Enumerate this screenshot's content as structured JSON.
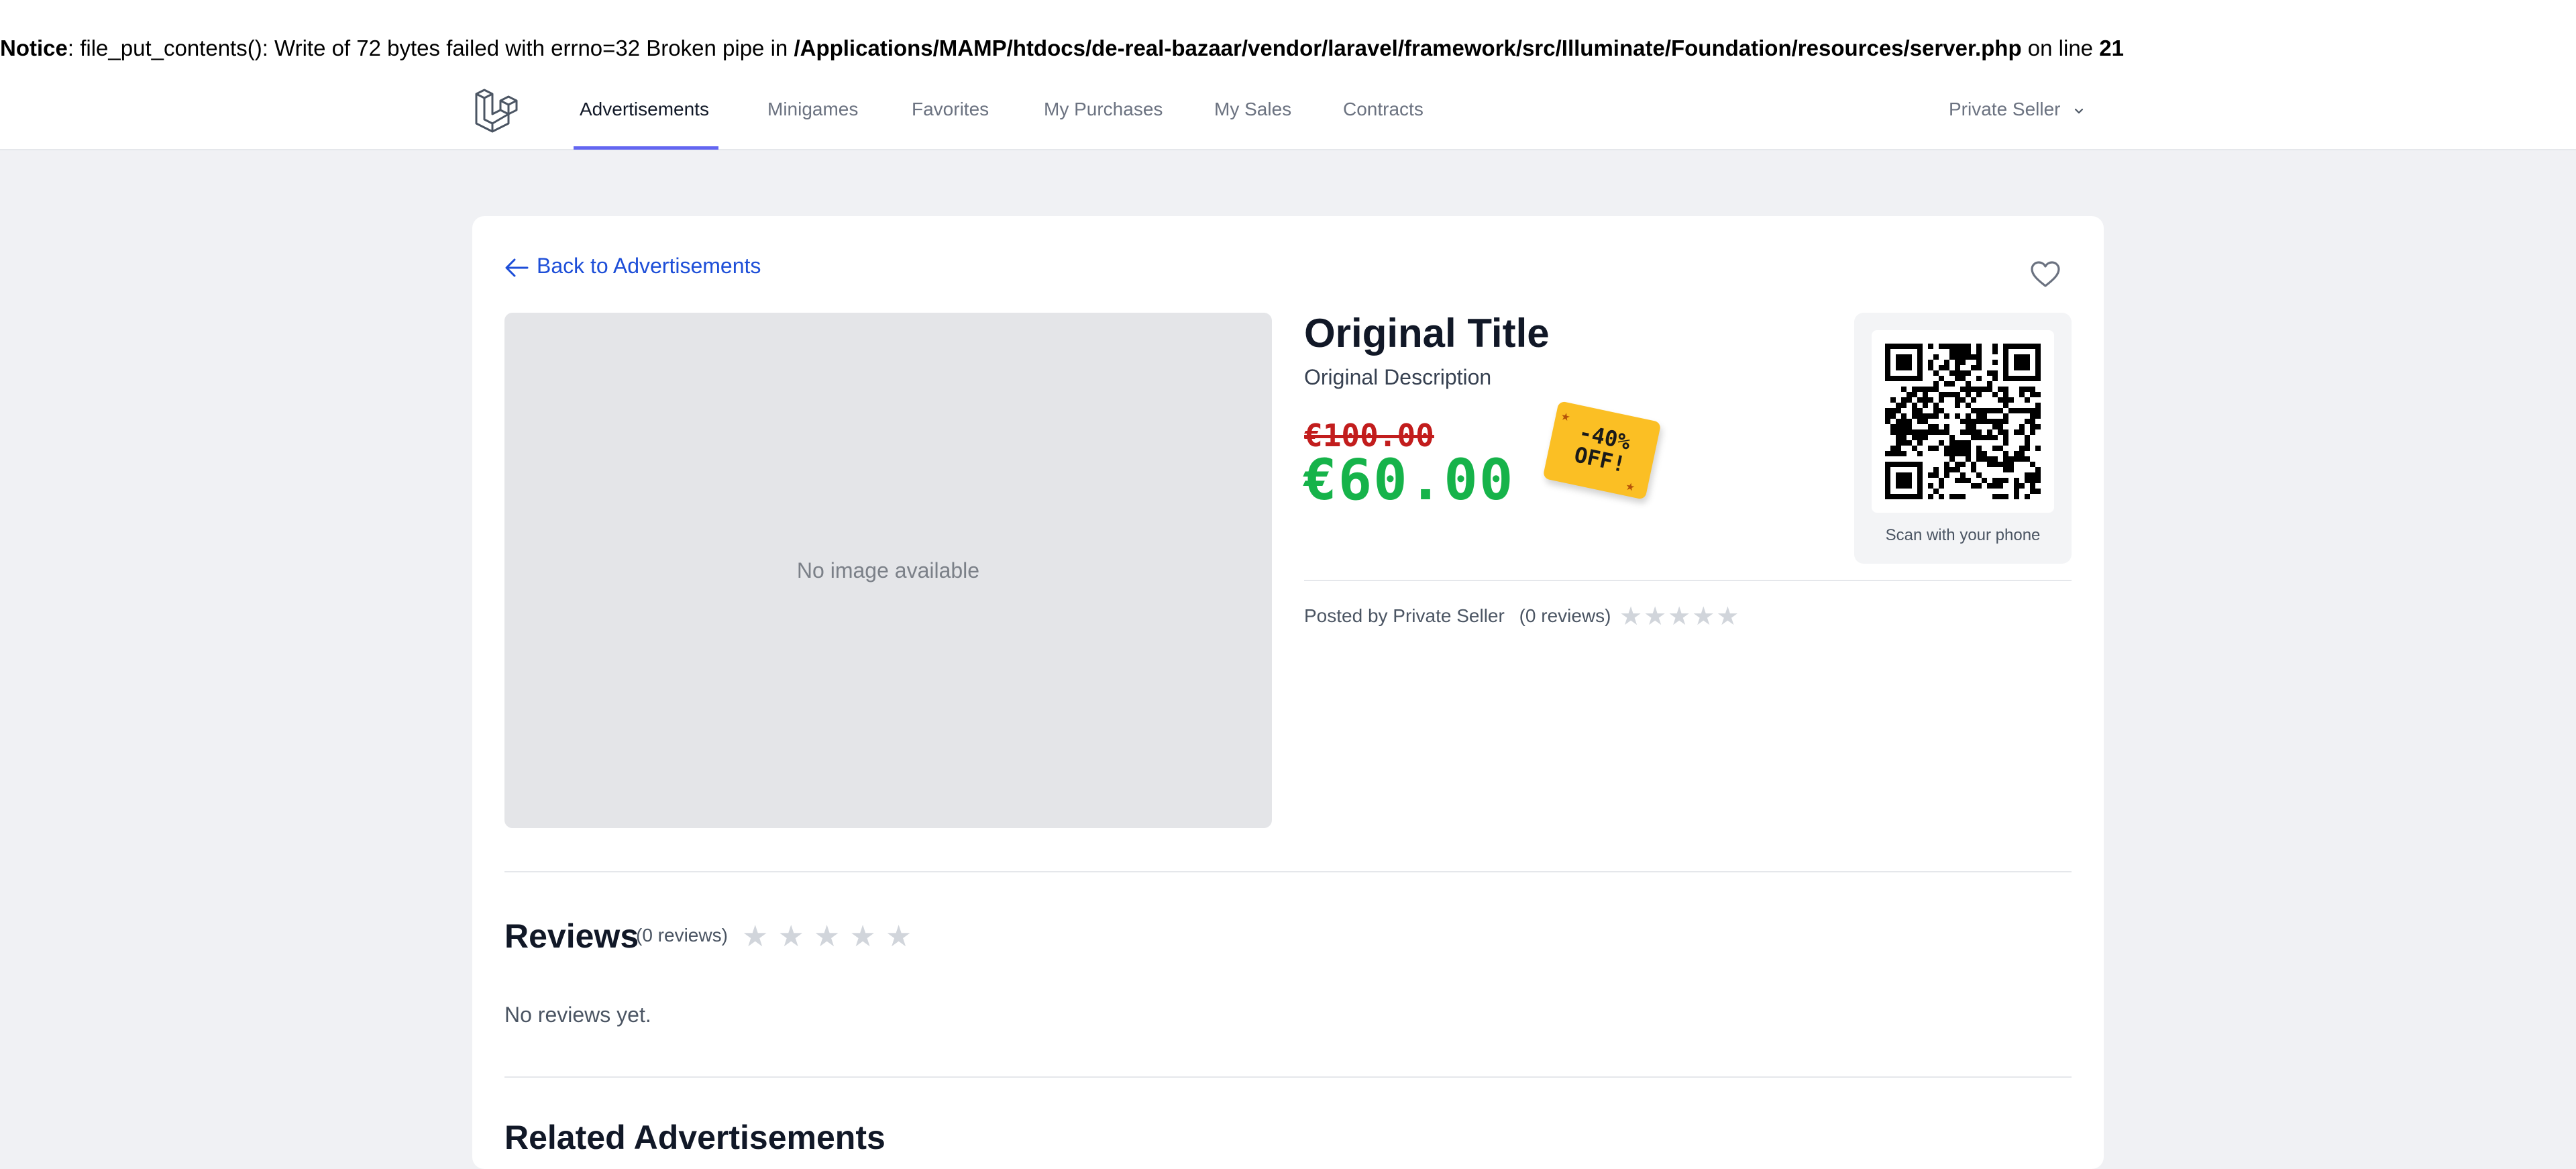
{
  "notice": {
    "label": "Notice",
    "message": ": file_put_contents(): Write of 72 bytes failed with errno=32 Broken pipe in ",
    "path": "/Applications/MAMP/htdocs/de-real-bazaar/vendor/laravel/framework/src/Illuminate/Foundation/resources/server.php",
    "on_line_text": " on line ",
    "line_number": "21"
  },
  "nav": {
    "logo_icon": "laravel-logo-icon",
    "links": [
      {
        "label": "Advertisements",
        "active": true
      },
      {
        "label": "Minigames",
        "active": false
      },
      {
        "label": "Favorites",
        "active": false
      },
      {
        "label": "My Purchases",
        "active": false
      },
      {
        "label": "My Sales",
        "active": false
      },
      {
        "label": "Contracts",
        "active": false
      }
    ],
    "user_menu": {
      "label": "Private Seller",
      "icon": "chevron-down-icon"
    },
    "accent_color": "#6366f1"
  },
  "listing": {
    "back_link": "Back to Advertisements",
    "favorite_icon": "heart-icon",
    "image_placeholder": "No image available",
    "title": "Original Title",
    "description": "Original Description",
    "old_price": "€100.00",
    "new_price": "€60.00",
    "discount_line1": "-40%",
    "discount_line2": "OFF!",
    "qr_caption": "Scan with your phone",
    "posted_by": "Posted by Private Seller",
    "review_count": "(0 reviews)",
    "rating": 0,
    "rating_max": 5,
    "price_color": "#16b34a",
    "old_price_color": "#c21d1d",
    "badge_color": "#fbbf24"
  },
  "reviews": {
    "title": "Reviews",
    "count": "(0 reviews)",
    "rating": 0,
    "empty_text": "No reviews yet."
  },
  "related": {
    "title": "Related Advertisements"
  }
}
